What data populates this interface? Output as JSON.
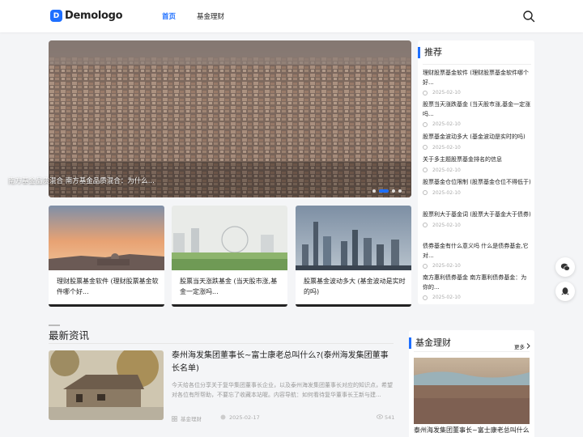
{
  "header": {
    "logo_text": "Demologo",
    "nav": [
      "首页",
      "基金理财"
    ]
  },
  "hero": {
    "caption": "南方基金品质混合 南方基金品质混合：为什么..."
  },
  "cards": [
    {
      "title": "理财股票基金软件 (理财股票基金软件哪个好..."
    },
    {
      "title": "股票当天涨跌基金 (当天股市涨,基金一定涨吗..."
    },
    {
      "title": "股票基金波动多大 (基金波动是实时的吗)"
    }
  ],
  "recommend": {
    "title": "推荐",
    "items": [
      {
        "title": "理财股票基金软件 (理财股票基金软件哪个好...",
        "date": "2025-02-10"
      },
      {
        "title": "股票当天涨跌基金 (当天股市涨,基金一定涨吗...",
        "date": "2025-02-10"
      },
      {
        "title": "股票基金波动多大 (基金波动是实时的吗)",
        "date": "2025-02-10"
      },
      {
        "title": "关于多主题股票基金排名的信息",
        "date": "2025-02-10"
      },
      {
        "title": "股票基金仓位限制 (股票基金仓位不得低于)",
        "date": "2025-02-10"
      },
      {
        "title": "股票利大于基金词 (股票大于基金大于债券)",
        "date": "2025-02-10"
      },
      {
        "title": "债券基金有什么意义吗 什么是债券基金,它对...",
        "date": "2025-02-10"
      },
      {
        "title": "南方惠利债券基金 南方惠利债券基金：为你的...",
        "date": "2025-02-10"
      }
    ]
  },
  "latest": {
    "section_title": "最新资讯",
    "item": {
      "title": "泰州海发集团董事长~富士康老总叫什么?(泰州海发集团董事长名单)",
      "desc": "今天给各位分享关于复华集团董事长企业，以及泰州海发集团董事长对应的知识点，希望对各位有所帮助，不要忘了收藏本站喔。内容导航：如何看待复华董事长王新与建...",
      "category": "基金理财",
      "date": "2025-02-17",
      "views": "541"
    }
  },
  "fund": {
    "title": "基金理财",
    "more": "更多",
    "caption": "泰州海发集团董事长~富士康老总叫什么"
  },
  "colors": {
    "accent": "#1e6fff"
  },
  "icons": [
    "search-icon",
    "wechat-icon",
    "qq-icon",
    "clock-icon",
    "eye-icon",
    "folder-icon",
    "chevron-right-icon"
  ]
}
